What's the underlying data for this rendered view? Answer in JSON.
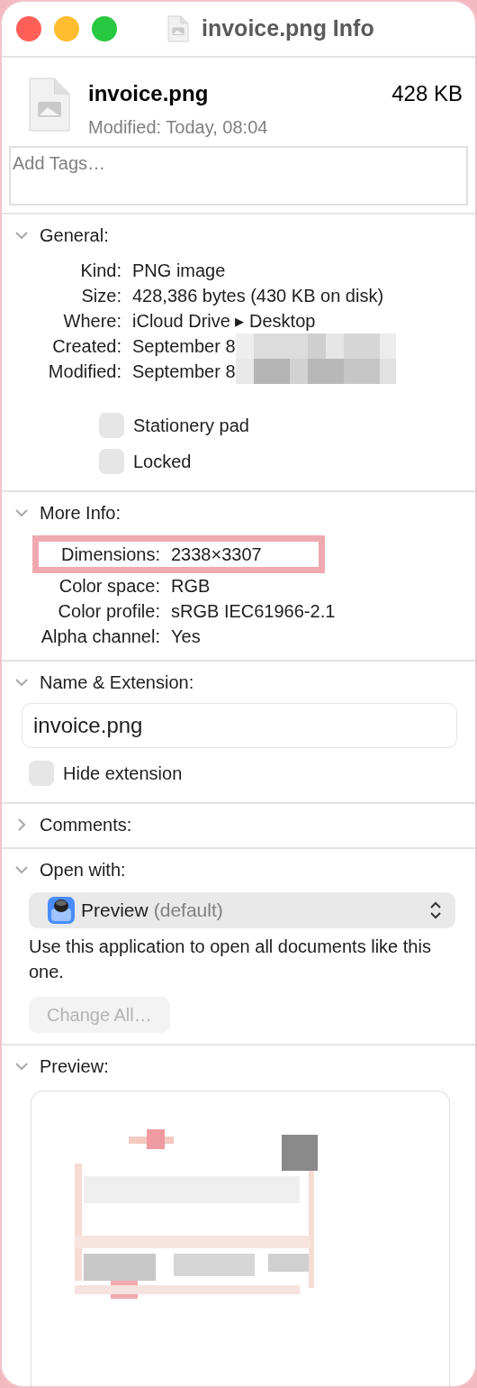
{
  "window": {
    "title": "invoice.png Info"
  },
  "header": {
    "name": "invoice.png",
    "size": "428 KB",
    "modified": "Modified: Today, 08:04"
  },
  "tags": {
    "placeholder": "Add Tags…"
  },
  "sections": [
    {
      "kind": "general",
      "title": "General:",
      "expanded": true,
      "fields": [
        {
          "label": "Kind:",
          "value": "PNG image"
        },
        {
          "label": "Size:",
          "value": "428,386 bytes (430 KB on disk)"
        },
        {
          "label": "Where:",
          "value": "iCloud Drive ▸ Desktop"
        },
        {
          "label": "Created:",
          "value": "September 8",
          "redacted": true
        },
        {
          "label": "Modified:",
          "value": "September 8",
          "redacted": true
        }
      ],
      "checkboxes": [
        {
          "label": "Stationery pad",
          "checked": false
        },
        {
          "label": "Locked",
          "checked": false
        }
      ]
    },
    {
      "kind": "info",
      "title": "More Info:",
      "expanded": true,
      "fields": [
        {
          "label": "Dimensions:",
          "value": "2338×3307",
          "highlighted": true
        },
        {
          "label": "Color space:",
          "value": "RGB"
        },
        {
          "label": "Color profile:",
          "value": "sRGB IEC61966-2.1"
        },
        {
          "label": "Alpha channel:",
          "value": "Yes"
        }
      ]
    },
    {
      "kind": "name",
      "title": "Name & Extension:",
      "expanded": true,
      "value": "invoice.png",
      "checkboxes": [
        {
          "label": "Hide extension",
          "checked": false
        }
      ]
    },
    {
      "kind": "comments",
      "title": "Comments:",
      "expanded": false
    },
    {
      "kind": "openwith",
      "title": "Open with:",
      "expanded": true,
      "app": "Preview",
      "app_note": "(default)",
      "description": "Use this application to open all documents like this one.",
      "button": {
        "label": "Change All…",
        "disabled": true
      }
    },
    {
      "kind": "preview",
      "title": "Preview:",
      "expanded": true
    }
  ]
}
